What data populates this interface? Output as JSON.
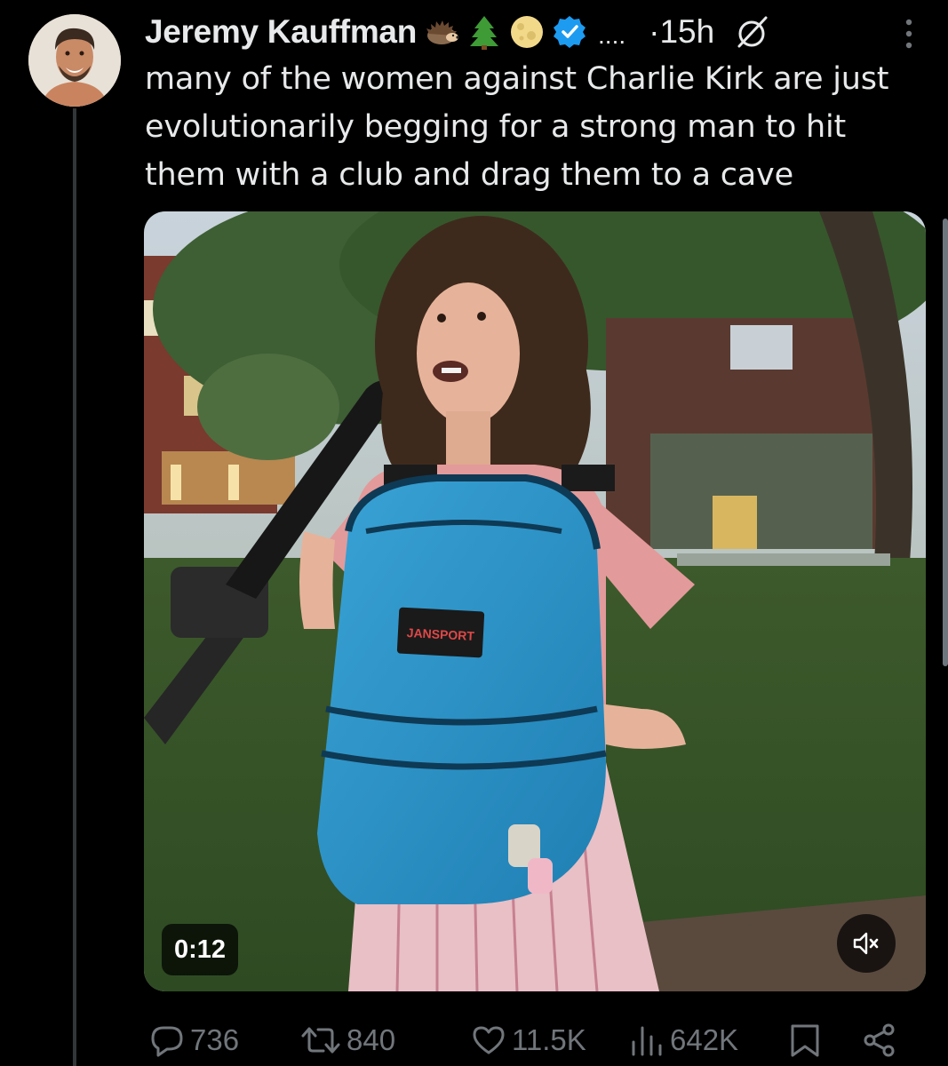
{
  "author": {
    "name": "Jeremy Kauffman",
    "badges": [
      "hedgehog-emoji",
      "evergreen-tree-emoji",
      "full-moon-emoji",
      "verified-badge"
    ],
    "ellipsis": "....",
    "time": "·15h"
  },
  "tweet": {
    "text": "many of the women against Charlie Kirk are just evolutionarily begging for a strong man to hit them with a club and drag them to a cave"
  },
  "video": {
    "timestamp": "0:12",
    "backpack_label": "JANSPORT"
  },
  "actions": {
    "replies": "736",
    "reposts": "840",
    "likes": "11.5K",
    "views": "642K"
  },
  "colors": {
    "background": "#000000",
    "text": "#e7e9ea",
    "muted": "#71767b",
    "verified": "#1d9bf0"
  }
}
